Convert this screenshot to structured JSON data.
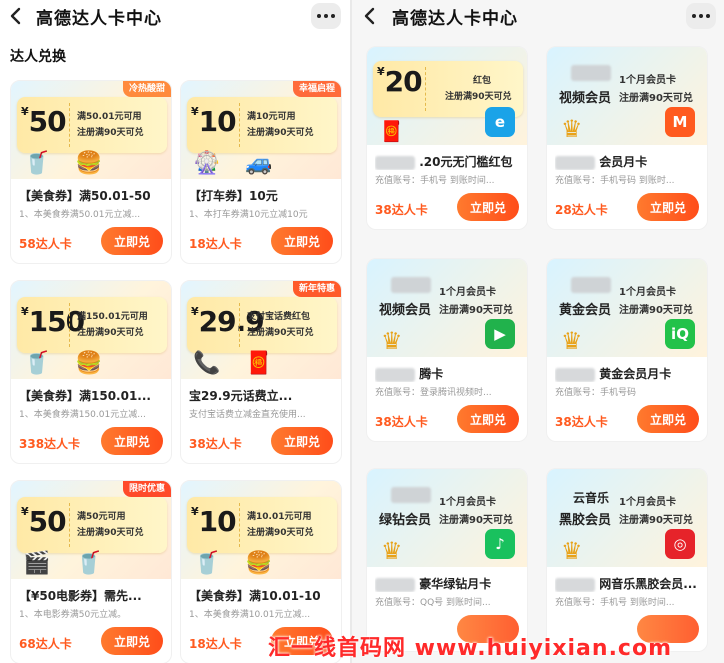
{
  "left": {
    "title": "高德达人卡中心",
    "section": "达人兑换",
    "cards": [
      {
        "amount": "50",
        "line1": "满50.01元可用",
        "line2": "注册满90天可兑",
        "badge": "冷热酸甜",
        "badge_color": "#ff8a3d",
        "name": "【美食券】满50.01-50",
        "desc": "1、本美食券满50.01元立减...",
        "price": "58达人卡",
        "button": "立即兑",
        "deco": [
          "🥤",
          "🍔"
        ]
      },
      {
        "amount": "10",
        "line1": "满10元可用",
        "line2": "注册满90天可兑",
        "badge": "幸福启程",
        "badge_color": "#ff6b3a",
        "name": "【打车券】10元",
        "desc": "1、本打车券满10元立减10元",
        "price": "18达人卡",
        "button": "立即兑",
        "deco": [
          "🎡",
          "🚙"
        ]
      },
      {
        "amount": "150",
        "line1": "满150.01元可用",
        "line2": "注册满90天可兑",
        "badge": "",
        "badge_color": "",
        "name": "【美食券】满150.01...",
        "desc": "1、本美食券满150.01元立减...",
        "price": "338达人卡",
        "button": "立即兑",
        "deco": [
          "🥤",
          "🍔"
        ]
      },
      {
        "amount": "29.9",
        "line1": "支付宝话费红包",
        "line2": "注册满90天可兑",
        "badge": "新年特惠",
        "badge_color": "#ff5a2a",
        "name": "宝29.9元话费立...",
        "desc": "支付宝话费立减金直充使用...",
        "price": "38达人卡",
        "button": "立即兑",
        "deco": [
          "📞",
          "🧧"
        ]
      },
      {
        "amount": "50",
        "line1": "满50元可用",
        "line2": "注册满90天可兑",
        "badge": "限时优惠",
        "badge_color": "#ff4a2a",
        "name": "【¥50电影券】需先...",
        "desc": "1、本电影券满50元立减。",
        "price": "68达人卡",
        "button": "立即兑",
        "deco": [
          "🎬",
          "🥤"
        ]
      },
      {
        "amount": "10",
        "line1": "满10.01元可用",
        "line2": "注册满90天可兑",
        "badge": "",
        "badge_color": "",
        "name": "【美食券】满10.01-10",
        "desc": "1、本美食券满10.01元立减...",
        "price": "18达人卡",
        "button": "立即兑",
        "deco": [
          "🥤",
          "🍔"
        ]
      }
    ]
  },
  "right": {
    "title": "高德达人卡中心",
    "cards": [
      {
        "type": "coupon",
        "amount": "20",
        "line1": "红包",
        "line2": "注册满90天可兑",
        "name": ".20元无门槛红包",
        "desc": "充值账号：手机号  到账时间...",
        "price": "38达人卡",
        "button": "立即兑",
        "logo": "e",
        "logo_color": "#1aa3e8"
      },
      {
        "type": "vip",
        "vname": "视频会员",
        "line1": "1个月会员卡",
        "line2": "注册满90天可兑",
        "name": "会员月卡",
        "desc": "充值账号：手机号码  到账时...",
        "price": "28达人卡",
        "button": "立即兑",
        "logo": "M",
        "logo_color": "#ff5a1f"
      },
      {
        "type": "vip",
        "vname": "视频会员",
        "line1": "1个月会员卡",
        "line2": "注册满90天可兑",
        "name": "腾卡",
        "desc": "充值账号：登录腾讯视频时...",
        "price": "38达人卡",
        "button": "立即兑",
        "logo": "▶",
        "logo_color": "#21b24c"
      },
      {
        "type": "vip",
        "vname": "黄金会员",
        "line1": "1个月会员卡",
        "line2": "注册满90天可兑",
        "name": "黄金会员月卡",
        "desc": "充值账号：手机号码",
        "price": "38达人卡",
        "button": "立即兑",
        "logo": "iQ",
        "logo_color": "#22c24a"
      },
      {
        "type": "vip",
        "vname": "绿钻会员",
        "line1": "1个月会员卡",
        "line2": "注册满90天可兑",
        "name": "豪华绿钻月卡",
        "desc": "充值账号：QQ号  到账时间...",
        "price": "",
        "button": "",
        "logo": "♪",
        "logo_color": "#19c15e"
      },
      {
        "type": "vip",
        "vname": "黑胶会员",
        "line1": "1个月会员卡",
        "line2": "注册满90天可兑",
        "name": "网音乐黑胶会员...",
        "desc": "充值账号：手机号  到账时间...",
        "price": "",
        "button": "",
        "logo": "◎",
        "logo_color": "#e6232a",
        "prefix": "云音乐"
      }
    ]
  },
  "watermark": "汇一线首码网 www.huiyixian.com"
}
